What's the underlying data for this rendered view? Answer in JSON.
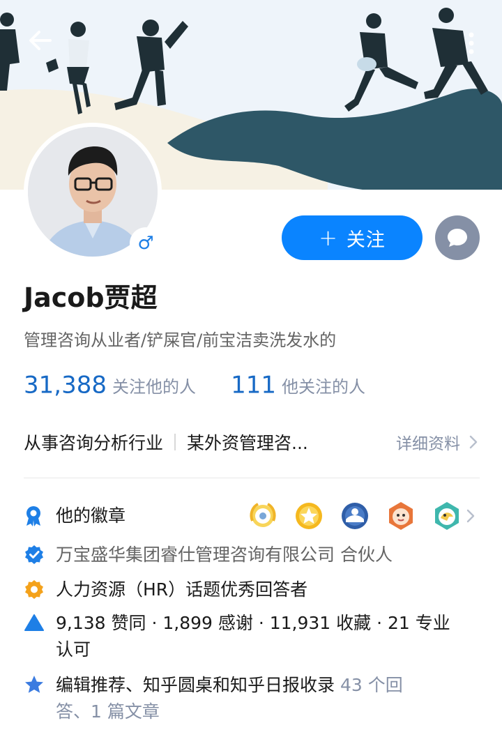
{
  "profile": {
    "name": "Jacob贾超",
    "headline": "管理咨询从业者/铲屎官/前宝洁卖洗发水的",
    "gender_symbol": "♂",
    "follow_label": "关注",
    "followers": {
      "count": "31,388",
      "label": "关注他的人"
    },
    "following": {
      "count": "111",
      "label": "他关注的人"
    },
    "industry": "从事咨询分析行业",
    "company_short": "某外资管理咨...",
    "detail_label": "详细资料"
  },
  "badges": {
    "label": "他的徽章",
    "medals": [
      "medal-gold-wreath-icon",
      "medal-gold-star-icon",
      "medal-blue-crest-icon",
      "medal-orange-face-icon",
      "medal-teal-bird-icon"
    ]
  },
  "credentials": {
    "company_role": "万宝盛华集团睿仕管理咨询有限公司 合伙人",
    "topic_answerer": "人力资源（HR）话题优秀回答者",
    "stats_line1": "9,138 赞同 · 1,899 感谢 · 11,931 收藏 · 21 专业",
    "stats_line2": "认可",
    "featured_main": "编辑推荐、知乎圆桌和知乎日报收录",
    "featured_count1": " 43 个回",
    "featured_count2": "答、1 篇文章"
  },
  "colors": {
    "accent": "#0a84ff",
    "link_blue": "#1769c5",
    "icon_blue": "#1e7fe6",
    "icon_orange": "#f4a21b",
    "grey_text": "#8590a6",
    "banner_bg": "#eef4fa",
    "banner_dark": "#2e5767"
  }
}
